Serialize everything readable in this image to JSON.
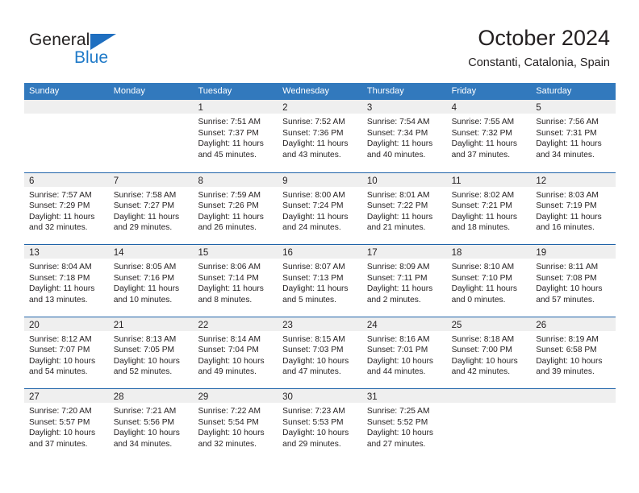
{
  "brand": {
    "name_part1": "General",
    "name_part2": "Blue",
    "color_dark": "#221f1f",
    "color_blue": "#1f7ac8"
  },
  "header": {
    "title": "October 2024",
    "subtitle": "Constanti, Catalonia, Spain"
  },
  "theme": {
    "header_blue": "#3279bd",
    "row_line_blue": "#1f63a8",
    "day_band_gray": "#efefef",
    "text": "#231f20"
  },
  "calendar": {
    "weekdays": [
      "Sunday",
      "Monday",
      "Tuesday",
      "Wednesday",
      "Thursday",
      "Friday",
      "Saturday"
    ],
    "weeks": [
      [
        {
          "day": "",
          "lines": []
        },
        {
          "day": "",
          "lines": []
        },
        {
          "day": "1",
          "lines": [
            "Sunrise: 7:51 AM",
            "Sunset: 7:37 PM",
            "Daylight: 11 hours",
            "and 45 minutes."
          ]
        },
        {
          "day": "2",
          "lines": [
            "Sunrise: 7:52 AM",
            "Sunset: 7:36 PM",
            "Daylight: 11 hours",
            "and 43 minutes."
          ]
        },
        {
          "day": "3",
          "lines": [
            "Sunrise: 7:54 AM",
            "Sunset: 7:34 PM",
            "Daylight: 11 hours",
            "and 40 minutes."
          ]
        },
        {
          "day": "4",
          "lines": [
            "Sunrise: 7:55 AM",
            "Sunset: 7:32 PM",
            "Daylight: 11 hours",
            "and 37 minutes."
          ]
        },
        {
          "day": "5",
          "lines": [
            "Sunrise: 7:56 AM",
            "Sunset: 7:31 PM",
            "Daylight: 11 hours",
            "and 34 minutes."
          ]
        }
      ],
      [
        {
          "day": "6",
          "lines": [
            "Sunrise: 7:57 AM",
            "Sunset: 7:29 PM",
            "Daylight: 11 hours",
            "and 32 minutes."
          ]
        },
        {
          "day": "7",
          "lines": [
            "Sunrise: 7:58 AM",
            "Sunset: 7:27 PM",
            "Daylight: 11 hours",
            "and 29 minutes."
          ]
        },
        {
          "day": "8",
          "lines": [
            "Sunrise: 7:59 AM",
            "Sunset: 7:26 PM",
            "Daylight: 11 hours",
            "and 26 minutes."
          ]
        },
        {
          "day": "9",
          "lines": [
            "Sunrise: 8:00 AM",
            "Sunset: 7:24 PM",
            "Daylight: 11 hours",
            "and 24 minutes."
          ]
        },
        {
          "day": "10",
          "lines": [
            "Sunrise: 8:01 AM",
            "Sunset: 7:22 PM",
            "Daylight: 11 hours",
            "and 21 minutes."
          ]
        },
        {
          "day": "11",
          "lines": [
            "Sunrise: 8:02 AM",
            "Sunset: 7:21 PM",
            "Daylight: 11 hours",
            "and 18 minutes."
          ]
        },
        {
          "day": "12",
          "lines": [
            "Sunrise: 8:03 AM",
            "Sunset: 7:19 PM",
            "Daylight: 11 hours",
            "and 16 minutes."
          ]
        }
      ],
      [
        {
          "day": "13",
          "lines": [
            "Sunrise: 8:04 AM",
            "Sunset: 7:18 PM",
            "Daylight: 11 hours",
            "and 13 minutes."
          ]
        },
        {
          "day": "14",
          "lines": [
            "Sunrise: 8:05 AM",
            "Sunset: 7:16 PM",
            "Daylight: 11 hours",
            "and 10 minutes."
          ]
        },
        {
          "day": "15",
          "lines": [
            "Sunrise: 8:06 AM",
            "Sunset: 7:14 PM",
            "Daylight: 11 hours",
            "and 8 minutes."
          ]
        },
        {
          "day": "16",
          "lines": [
            "Sunrise: 8:07 AM",
            "Sunset: 7:13 PM",
            "Daylight: 11 hours",
            "and 5 minutes."
          ]
        },
        {
          "day": "17",
          "lines": [
            "Sunrise: 8:09 AM",
            "Sunset: 7:11 PM",
            "Daylight: 11 hours",
            "and 2 minutes."
          ]
        },
        {
          "day": "18",
          "lines": [
            "Sunrise: 8:10 AM",
            "Sunset: 7:10 PM",
            "Daylight: 11 hours",
            "and 0 minutes."
          ]
        },
        {
          "day": "19",
          "lines": [
            "Sunrise: 8:11 AM",
            "Sunset: 7:08 PM",
            "Daylight: 10 hours",
            "and 57 minutes."
          ]
        }
      ],
      [
        {
          "day": "20",
          "lines": [
            "Sunrise: 8:12 AM",
            "Sunset: 7:07 PM",
            "Daylight: 10 hours",
            "and 54 minutes."
          ]
        },
        {
          "day": "21",
          "lines": [
            "Sunrise: 8:13 AM",
            "Sunset: 7:05 PM",
            "Daylight: 10 hours",
            "and 52 minutes."
          ]
        },
        {
          "day": "22",
          "lines": [
            "Sunrise: 8:14 AM",
            "Sunset: 7:04 PM",
            "Daylight: 10 hours",
            "and 49 minutes."
          ]
        },
        {
          "day": "23",
          "lines": [
            "Sunrise: 8:15 AM",
            "Sunset: 7:03 PM",
            "Daylight: 10 hours",
            "and 47 minutes."
          ]
        },
        {
          "day": "24",
          "lines": [
            "Sunrise: 8:16 AM",
            "Sunset: 7:01 PM",
            "Daylight: 10 hours",
            "and 44 minutes."
          ]
        },
        {
          "day": "25",
          "lines": [
            "Sunrise: 8:18 AM",
            "Sunset: 7:00 PM",
            "Daylight: 10 hours",
            "and 42 minutes."
          ]
        },
        {
          "day": "26",
          "lines": [
            "Sunrise: 8:19 AM",
            "Sunset: 6:58 PM",
            "Daylight: 10 hours",
            "and 39 minutes."
          ]
        }
      ],
      [
        {
          "day": "27",
          "lines": [
            "Sunrise: 7:20 AM",
            "Sunset: 5:57 PM",
            "Daylight: 10 hours",
            "and 37 minutes."
          ]
        },
        {
          "day": "28",
          "lines": [
            "Sunrise: 7:21 AM",
            "Sunset: 5:56 PM",
            "Daylight: 10 hours",
            "and 34 minutes."
          ]
        },
        {
          "day": "29",
          "lines": [
            "Sunrise: 7:22 AM",
            "Sunset: 5:54 PM",
            "Daylight: 10 hours",
            "and 32 minutes."
          ]
        },
        {
          "day": "30",
          "lines": [
            "Sunrise: 7:23 AM",
            "Sunset: 5:53 PM",
            "Daylight: 10 hours",
            "and 29 minutes."
          ]
        },
        {
          "day": "31",
          "lines": [
            "Sunrise: 7:25 AM",
            "Sunset: 5:52 PM",
            "Daylight: 10 hours",
            "and 27 minutes."
          ]
        },
        {
          "day": "",
          "lines": []
        },
        {
          "day": "",
          "lines": []
        }
      ]
    ]
  }
}
